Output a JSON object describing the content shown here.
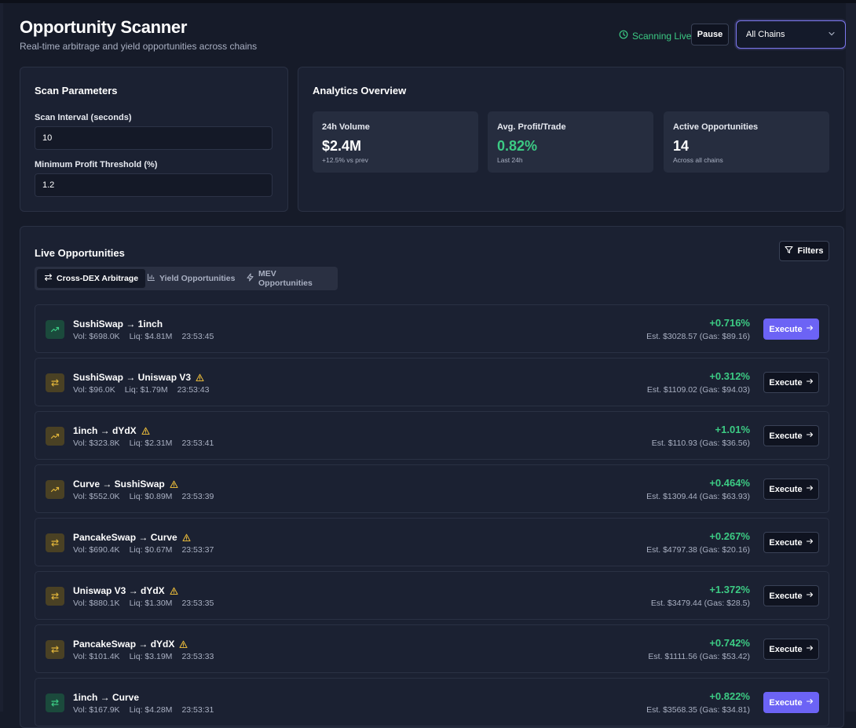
{
  "header": {
    "title": "Opportunity Scanner",
    "subtitle": "Real-time arbitrage and yield opportunities across chains",
    "status_text": "Scanning Live",
    "pause_label": "Pause",
    "chain_select_value": "All Chains"
  },
  "scan_params": {
    "title": "Scan Parameters",
    "interval_label": "Scan Interval (seconds)",
    "interval_value": "10",
    "threshold_label": "Minimum Profit Threshold (%)",
    "threshold_value": "1.2"
  },
  "analytics": {
    "title": "Analytics Overview",
    "stats": [
      {
        "label": "24h Volume",
        "value": "$2.4M",
        "sub": "+12.5% vs prev"
      },
      {
        "label": "Avg. Profit/Trade",
        "value": "0.82%",
        "sub": "Last 24h"
      },
      {
        "label": "Active Opportunities",
        "value": "14",
        "sub": "Across all chains"
      }
    ]
  },
  "opportunities": {
    "title": "Live Opportunities",
    "filters_label": "Filters",
    "tabs": [
      {
        "label": "Cross-DEX Arbitrage",
        "icon": "arrows-left-right-icon"
      },
      {
        "label": "Yield Opportunities",
        "icon": "bar-chart-icon"
      },
      {
        "label": "MEV Opportunities",
        "icon": "lightning-icon"
      }
    ],
    "execute_label": "Execute",
    "rows": [
      {
        "name": "SushiSwap → 1inch",
        "vol": "Vol: $698.0K",
        "liq": "Liq: $4.81M",
        "time": "23:53:45",
        "profit": "+0.716%",
        "est": "Est. $3028.57 (Gas: $89.16)",
        "icon": "trend-up-icon",
        "tone": "green",
        "warning": false,
        "primary": true
      },
      {
        "name": "SushiSwap → Uniswap V3",
        "vol": "Vol: $96.0K",
        "liq": "Liq: $1.79M",
        "time": "23:53:43",
        "profit": "+0.312%",
        "est": "Est. $1109.02 (Gas: $94.03)",
        "icon": "swap-icon",
        "tone": "amber",
        "warning": true,
        "primary": false
      },
      {
        "name": "1inch → dYdX",
        "vol": "Vol: $323.8K",
        "liq": "Liq: $2.31M",
        "time": "23:53:41",
        "profit": "+1.01%",
        "est": "Est. $110.93 (Gas: $36.56)",
        "icon": "trend-up-icon",
        "tone": "amber",
        "warning": true,
        "primary": false
      },
      {
        "name": "Curve → SushiSwap",
        "vol": "Vol: $552.0K",
        "liq": "Liq: $0.89M",
        "time": "23:53:39",
        "profit": "+0.464%",
        "est": "Est. $1309.44 (Gas: $63.93)",
        "icon": "trend-up-icon",
        "tone": "amber",
        "warning": true,
        "primary": false
      },
      {
        "name": "PancakeSwap → Curve",
        "vol": "Vol: $690.4K",
        "liq": "Liq: $0.67M",
        "time": "23:53:37",
        "profit": "+0.267%",
        "est": "Est. $4797.38 (Gas: $20.16)",
        "icon": "swap-icon",
        "tone": "amber",
        "warning": true,
        "primary": false
      },
      {
        "name": "Uniswap V3 → dYdX",
        "vol": "Vol: $880.1K",
        "liq": "Liq: $1.30M",
        "time": "23:53:35",
        "profit": "+1.372%",
        "est": "Est. $3479.44 (Gas: $28.5)",
        "icon": "swap-icon",
        "tone": "amber",
        "warning": true,
        "primary": false
      },
      {
        "name": "PancakeSwap → dYdX",
        "vol": "Vol: $101.4K",
        "liq": "Liq: $3.19M",
        "time": "23:53:33",
        "profit": "+0.742%",
        "est": "Est. $1111.56 (Gas: $53.42)",
        "icon": "swap-icon",
        "tone": "amber",
        "warning": true,
        "primary": false
      },
      {
        "name": "1inch → Curve",
        "vol": "Vol: $167.9K",
        "liq": "Liq: $4.28M",
        "time": "23:53:31",
        "profit": "+0.822%",
        "est": "Est. $3568.35 (Gas: $34.81)",
        "icon": "swap-icon",
        "tone": "green",
        "warning": false,
        "primary": true
      }
    ]
  },
  "colors": {
    "accent": "#6c63f5",
    "positive": "#3ccb84",
    "warning": "#e0b43a",
    "background": "#161b29",
    "card": "#1b2132"
  }
}
